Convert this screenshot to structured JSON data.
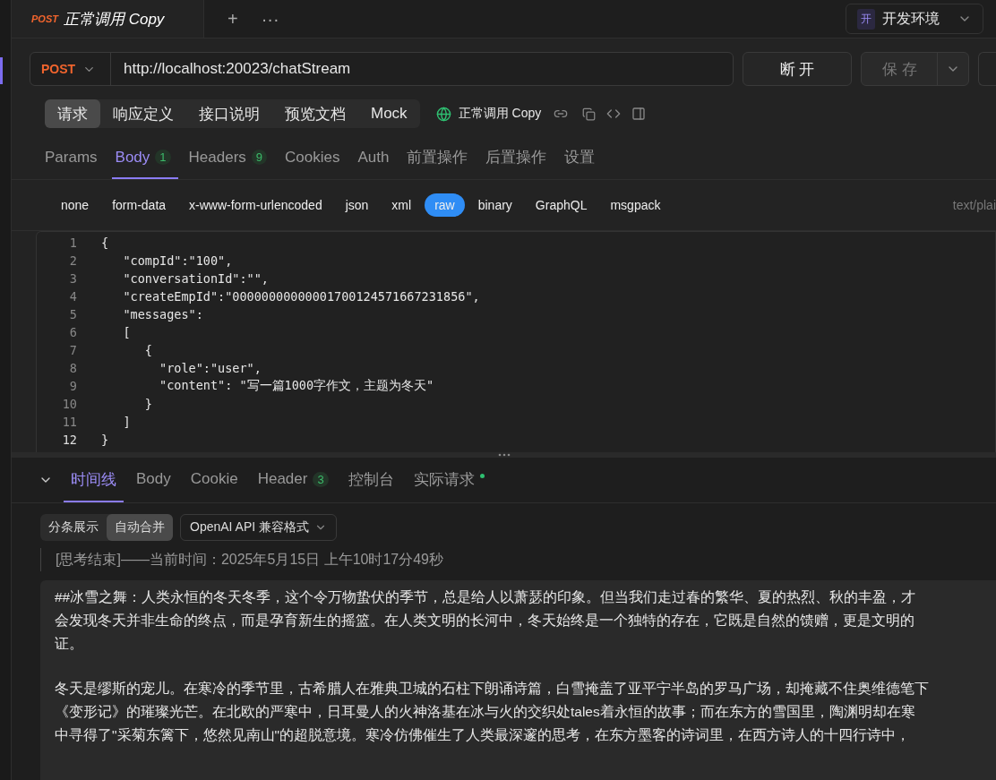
{
  "doc_tab": {
    "method": "POST",
    "title": "正常调用 Copy"
  },
  "tab_actions": [
    "+",
    "···"
  ],
  "environment": {
    "badge": "开",
    "label": "开发环境"
  },
  "request": {
    "method": "POST",
    "url": "http://localhost:20023/chatStream",
    "disconnect": "断 开",
    "save": "保 存"
  },
  "mode_tabs": [
    {
      "label": "请求",
      "selected": true
    },
    {
      "label": "响应定义",
      "selected": false
    },
    {
      "label": "接口说明",
      "selected": false
    },
    {
      "label": "预览文档",
      "selected": false
    },
    {
      "label": "Mock",
      "selected": false
    }
  ],
  "api_name": "正常调用 Copy",
  "param_tabs": [
    {
      "label": "Params",
      "selected": false
    },
    {
      "label": "Body",
      "count": "1",
      "selected": true
    },
    {
      "label": "Headers",
      "count": "9",
      "selected": false
    },
    {
      "label": "Cookies",
      "selected": false
    },
    {
      "label": "Auth",
      "selected": false
    },
    {
      "label": "前置操作",
      "selected": false
    },
    {
      "label": "后置操作",
      "selected": false
    },
    {
      "label": "设置",
      "selected": false
    }
  ],
  "body_types": [
    {
      "label": "none",
      "selected": false
    },
    {
      "label": "form-data",
      "selected": false
    },
    {
      "label": "x-www-form-urlencoded",
      "selected": false
    },
    {
      "label": "json",
      "selected": false
    },
    {
      "label": "xml",
      "selected": false
    },
    {
      "label": "raw",
      "selected": true
    },
    {
      "label": "binary",
      "selected": false
    },
    {
      "label": "GraphQL",
      "selected": false
    },
    {
      "label": "msgpack",
      "selected": false
    }
  ],
  "content_type": "text/plai",
  "code_lines": [
    {
      "number": "1",
      "text": "{"
    },
    {
      "number": "2",
      "text": "   \"compId\":\"100\","
    },
    {
      "number": "3",
      "text": "   \"conversationId\":\"\","
    },
    {
      "number": "4",
      "text": "   \"createEmpId\":\"00000000000001700124571667231856\","
    },
    {
      "number": "5",
      "text": "   \"messages\":"
    },
    {
      "number": "6",
      "text": "   ["
    },
    {
      "number": "7",
      "text": "      {"
    },
    {
      "number": "8",
      "text": "        \"role\":\"user\","
    },
    {
      "number": "9",
      "text": "        \"content\": \"写一篇1000字作文，主题为冬天\""
    },
    {
      "number": "10",
      "text": "      }"
    },
    {
      "number": "11",
      "text": "   ]"
    },
    {
      "number": "12",
      "text": "}"
    }
  ],
  "response_tabs": [
    {
      "label": "时间线",
      "selected": true
    },
    {
      "label": "Body",
      "selected": false
    },
    {
      "label": "Cookie",
      "selected": false
    },
    {
      "label": "Header",
      "count": "3",
      "selected": false
    },
    {
      "label": "控制台",
      "selected": false
    },
    {
      "label": "实际请求",
      "dot": true,
      "selected": false
    }
  ],
  "view_modes": [
    {
      "label": "分条展示",
      "selected": false
    },
    {
      "label": "自动合并",
      "selected": true
    }
  ],
  "format": "OpenAI API 兼容格式",
  "think_end": "[思考结束]——当前时间：2025年5月15日 上午10时17分49秒",
  "paragraphs": [
    [
      "##冰雪之舞：人类永恒的冬天冬季，这个令万物蛰伏的季节，总是给人以萧瑟的印象。但当我们走过春的繁华、夏的热烈、秋的丰盈，才",
      "会发现冬天并非生命的终点，而是孕育新生的摇篮。在人类文明的长河中，冬天始终是一个独特的存在，它既是自然的馈赠，更是文明的",
      "证。"
    ],
    [
      "冬天是缪斯的宠儿。在寒冷的季节里，古希腊人在雅典卫城的石柱下朗诵诗篇，白雪掩盖了亚平宁半岛的罗马广场，却掩藏不住奥维德笔下",
      "《变形记》的璀璨光芒。在北欧的严寒中，日耳曼人的火神洛基在冰与火的交织处tales着永恒的故事；而在东方的雪国里，陶渊明却在寒",
      "中寻得了\"采菊东篱下，悠然见南山\"的超脱意境。寒冷仿佛催生了人类最深邃的思考，在东方墨客的诗词里，在西方诗人的十四行诗中，"
    ]
  ]
}
